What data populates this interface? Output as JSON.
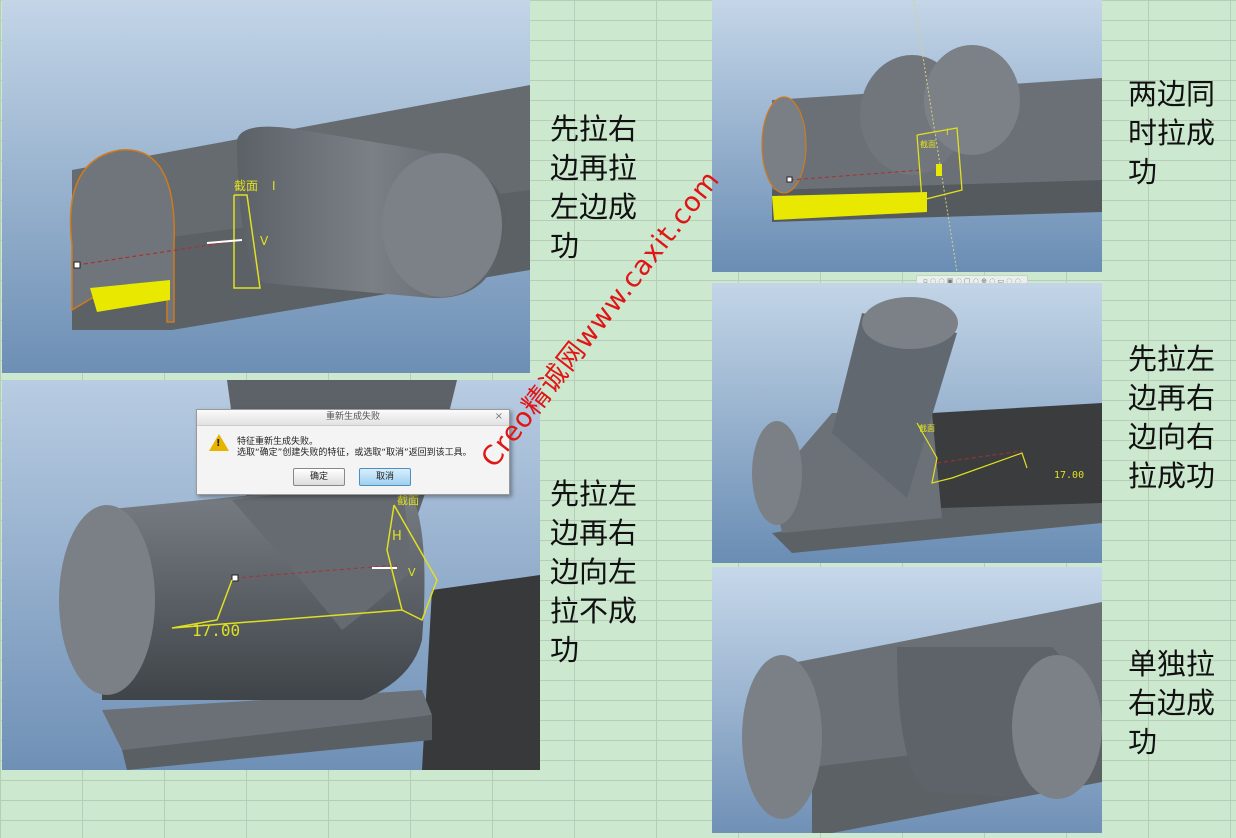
{
  "notes": {
    "top_left": [
      "先拉右",
      "边再拉",
      "左边成",
      "功"
    ],
    "top_right": [
      "两边同",
      "时拉成",
      "功"
    ],
    "mid_left": [
      "先拉左",
      "边再右",
      "边向左",
      "拉不成",
      "功"
    ],
    "mid_right": [
      "先拉左",
      "边再右",
      "边向右",
      "拉成功"
    ],
    "bottom_right": [
      "单独拉",
      "右边成",
      "功"
    ]
  },
  "panels": {
    "p1": {
      "section_label": "截面",
      "h_dim": "I",
      "v_dim": "V"
    },
    "p2": {
      "section_label": "截面",
      "dim_marker": "I"
    },
    "p3": {
      "section_label": "截面",
      "dim": "H",
      "v_dim": "V",
      "length": "17.00"
    },
    "p4": {
      "section_label": "截面",
      "length": "17.00"
    }
  },
  "dialog": {
    "title": "重新生成失败",
    "message_line1": "特征重新生成失败。",
    "message_line2": "选取“确定”创建失败的特征，或选取“取消”返回到该工具。",
    "ok_label": "确定",
    "cancel_label": "取消",
    "close_glyph": "×",
    "warn_glyph": "!"
  },
  "toolbar_glyphs": "▫ ◌ ◌ ▣ ◌ ▢ ◌ ⊕ ◌ ▭ ◌ ◌",
  "watermark": "Creo精诚网www.caxit.com",
  "colors": {
    "background": "#cce8cf",
    "body": "#6d7378",
    "highlight": "#e8e800",
    "sketch": "#e0e020",
    "edge": "#d07a1e"
  }
}
